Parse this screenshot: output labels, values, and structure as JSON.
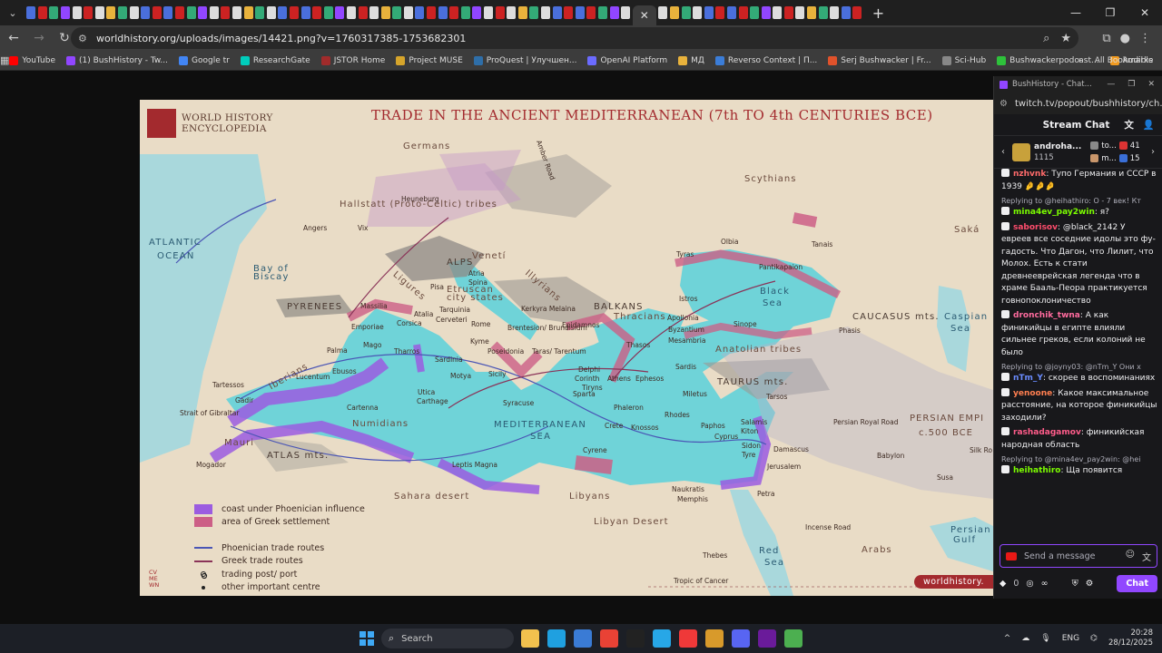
{
  "browser": {
    "url": "worldhistory.org/uploads/images/14421.png?v=1760317385-1753682301",
    "bookmarks": [
      {
        "label": "YouTube",
        "color": "#ff0000"
      },
      {
        "label": "(1) BushHistory - Tw...",
        "color": "#9146ff"
      },
      {
        "label": "Google tr",
        "color": "#4285f4"
      },
      {
        "label": "ResearchGate",
        "color": "#00ccbb"
      },
      {
        "label": "JSTOR Home",
        "color": "#a12b2b"
      },
      {
        "label": "Project MUSE",
        "color": "#d6a52b"
      },
      {
        "label": "ProQuest | Улучшен...",
        "color": "#2e6ea8"
      },
      {
        "label": "OpenAI Platform",
        "color": "#6b6bff"
      },
      {
        "label": "МД",
        "color": "#e8b23c"
      },
      {
        "label": "Reverso Context | П...",
        "color": "#3b7dd8"
      },
      {
        "label": "Serj Bushwacker | Fr...",
        "color": "#e0522b"
      },
      {
        "label": "Sci-Hub",
        "color": "#888888"
      },
      {
        "label": "Bushwackerpodcast...",
        "color": "#2ec23b"
      },
      {
        "label": "Audible",
        "color": "#f29b20"
      }
    ],
    "all_bookmarks": "All Bookmarks"
  },
  "map": {
    "title": "TRADE IN THE ANCIENT MEDITERRANEAN (7th TO 4th CENTURIES BCE)",
    "brand_line1": "WORLD HISTORY",
    "brand_line2": "ENCYCLOPEDIA",
    "brand_tag": "worldhistory.",
    "credit": "CV\nME\nWN",
    "regions": [
      {
        "text": "Germans",
        "cls": "region"
      },
      {
        "text": "Scythians",
        "cls": "region"
      },
      {
        "text": "Hallstatt (Proto-Celtic) tribes",
        "cls": "region"
      },
      {
        "text": "ATLANTIC",
        "cls": "sea"
      },
      {
        "text": "OCEAN",
        "cls": "sea"
      },
      {
        "text": "Bay of",
        "cls": "sea"
      },
      {
        "text": "Biscay",
        "cls": "sea"
      },
      {
        "text": "ALPS",
        "cls": "mtn"
      },
      {
        "text": "PYRENEES",
        "cls": "mtn"
      },
      {
        "text": "BALKANS",
        "cls": "mtn"
      },
      {
        "text": "Thracians",
        "cls": "region"
      },
      {
        "text": "Black",
        "cls": "sea"
      },
      {
        "text": "Sea",
        "cls": "sea"
      },
      {
        "text": "CAUCASUS mts.",
        "cls": "mtn"
      },
      {
        "text": "Saká",
        "cls": "region"
      },
      {
        "text": "Caspian",
        "cls": "sea"
      },
      {
        "text": "Sea",
        "cls": "sea"
      },
      {
        "text": "Anatolian tribes",
        "cls": "region"
      },
      {
        "text": "TAURUS mts.",
        "cls": "mtn"
      },
      {
        "text": "PERSIAN EMPI",
        "cls": "region"
      },
      {
        "text": "c.500 BCE",
        "cls": "region"
      },
      {
        "text": "MEDITERRANEAN",
        "cls": "sea"
      },
      {
        "text": "SEA",
        "cls": "sea"
      },
      {
        "text": "Numidians",
        "cls": "region"
      },
      {
        "text": "Mauri",
        "cls": "region"
      },
      {
        "text": "ATLAS mts.",
        "cls": "mtn"
      },
      {
        "text": "Sahara desert",
        "cls": "region"
      },
      {
        "text": "Libyans",
        "cls": "region"
      },
      {
        "text": "Libyan Desert",
        "cls": "region"
      },
      {
        "text": "Arabs",
        "cls": "region"
      },
      {
        "text": "Red",
        "cls": "sea"
      },
      {
        "text": "Sea",
        "cls": "sea"
      },
      {
        "text": "Persian",
        "cls": "sea"
      },
      {
        "text": "Gulf",
        "cls": "sea"
      },
      {
        "text": "Venetí",
        "cls": "region"
      },
      {
        "text": "Etruscan",
        "cls": "region"
      },
      {
        "text": "city states",
        "cls": "region"
      },
      {
        "text": "Illyrians",
        "cls": "region"
      },
      {
        "text": "Ligures",
        "cls": "region"
      },
      {
        "text": "Iberians",
        "cls": "region"
      },
      {
        "text": "Tropic of Cancer",
        "cls": "city"
      },
      {
        "text": "Incense Road",
        "cls": "city"
      },
      {
        "text": "Persian Royal Road",
        "cls": "city"
      },
      {
        "text": "Amber Road",
        "cls": "city"
      },
      {
        "text": "Silk Ro",
        "cls": "city"
      }
    ],
    "cities": [
      "Angers",
      "Vix",
      "Heuneburg",
      "Massilia",
      "Emporiae",
      "Pisa",
      "Atria",
      "Spina",
      "Tarquinia",
      "Cerveteri",
      "Rome",
      "Kyme",
      "Poseidonia",
      "Brentesion/ Brundisium",
      "Taras/ Tarentum",
      "Epidamnos",
      "Kerkyra Melaina",
      "Atalia",
      "Corsica",
      "Sardinia",
      "Tharros",
      "Palma",
      "Mago",
      "Ebusos",
      "Lucentum",
      "Cartenna",
      "Tartessos",
      "Gadir",
      "Mogador",
      "Utica",
      "Carthage",
      "Motya",
      "Sicily",
      "Syracuse",
      "Delphi",
      "Corinth",
      "Athens",
      "Tiryns",
      "Sparta",
      "Phaleron",
      "Crete",
      "Knossos",
      "Ephesos",
      "Thasos",
      "Sardis",
      "Miletus",
      "Byzantium",
      "Mesambria",
      "Apollonia",
      "Istros",
      "Tyras",
      "Olbia",
      "Pantikapaion",
      "Tanais",
      "Sinope",
      "Phasis",
      "Tarsos",
      "Rhodes",
      "Salamis",
      "Kiton",
      "Paphos",
      "Cyprus",
      "Sidon",
      "Tyre",
      "Damascus",
      "Jerusalem",
      "Petra",
      "Naukratis",
      "Memphis",
      "Thebes",
      "Cyrene",
      "Leptis Magna",
      "Babylon",
      "Susa"
    ],
    "strait": "Strait of Gibraltar",
    "legend": [
      {
        "label": "coast under Phoenician influence",
        "kind": "swatch",
        "color": "#9b5ce0"
      },
      {
        "label": "area of Greek settlement",
        "kind": "swatch",
        "color": "#cc5f86"
      },
      {
        "label": "Phoenician trade routes",
        "kind": "line",
        "color": "#4a55b5"
      },
      {
        "label": "Greek trade routes",
        "kind": "line",
        "color": "#8a3358"
      },
      {
        "label": "trading post/ port",
        "kind": "circle",
        "color": "#222"
      },
      {
        "label": "other important centre",
        "kind": "dot",
        "color": "#222"
      }
    ]
  },
  "chat": {
    "window_title": "BushHistory - Chat...",
    "url": "twitch.tv/popout/bushhistory/ch...",
    "header": "Stream Chat",
    "leaderboard": {
      "top_name": "androha...",
      "top_count": "1115",
      "second_name": "to...",
      "second_count": "41",
      "third_name": "m...",
      "third_count": "15"
    },
    "messages": [
      {
        "reply": "",
        "user": "nzhvnk",
        "color": "#ff6b6b",
        "text": ": Тупо Германия и СССР в 1939 🤌🤌🤌"
      },
      {
        "reply": "Replying to @heihathiro: О - 7 век! Кт",
        "user": "mina4ev_pay2win",
        "color": "#7cfc00",
        "text": ": я?"
      },
      {
        "reply": "",
        "user": "saborisov",
        "color": "#ff4d6d",
        "text": ": @black_2142 У евреев все соседние идолы это фу-гадость. Что Дагон, что Лилит, что Молох. Есть к стати древнееврейская легенда что в храме Бааль-Пеора практикуется говнопоклоничество"
      },
      {
        "reply": "",
        "user": "dronchik_twna",
        "color": "#ff6b9e",
        "text": ": А как финикийцы в египте влияли сильнее греков, если колоний не было"
      },
      {
        "reply": "Replying to @joyny03: @nTm_Y Они х",
        "user": "nTm_Y",
        "color": "#6a8cff",
        "text": ": скорее в воспоминаниях"
      },
      {
        "reply": "",
        "user": "yenoone",
        "color": "#ff7f50",
        "text": ": Какое максимальное расстояние, на которое финикийцы заходили?"
      },
      {
        "reply": "",
        "user": "rashadagamov",
        "color": "#ff5c8a",
        "text": ": финикийская народная область"
      },
      {
        "reply": "Replying to @mina4ev_pay2win: @hei",
        "user": "heihathiro",
        "color": "#7cfc00",
        "text": ": Ща появится"
      }
    ],
    "input_placeholder": "Send a message",
    "bits": "0",
    "points": "∞",
    "send_label": "Chat"
  },
  "taskbar": {
    "search": "Search",
    "lang": "ENG",
    "time": "20:28",
    "date": "28/12/2025"
  }
}
